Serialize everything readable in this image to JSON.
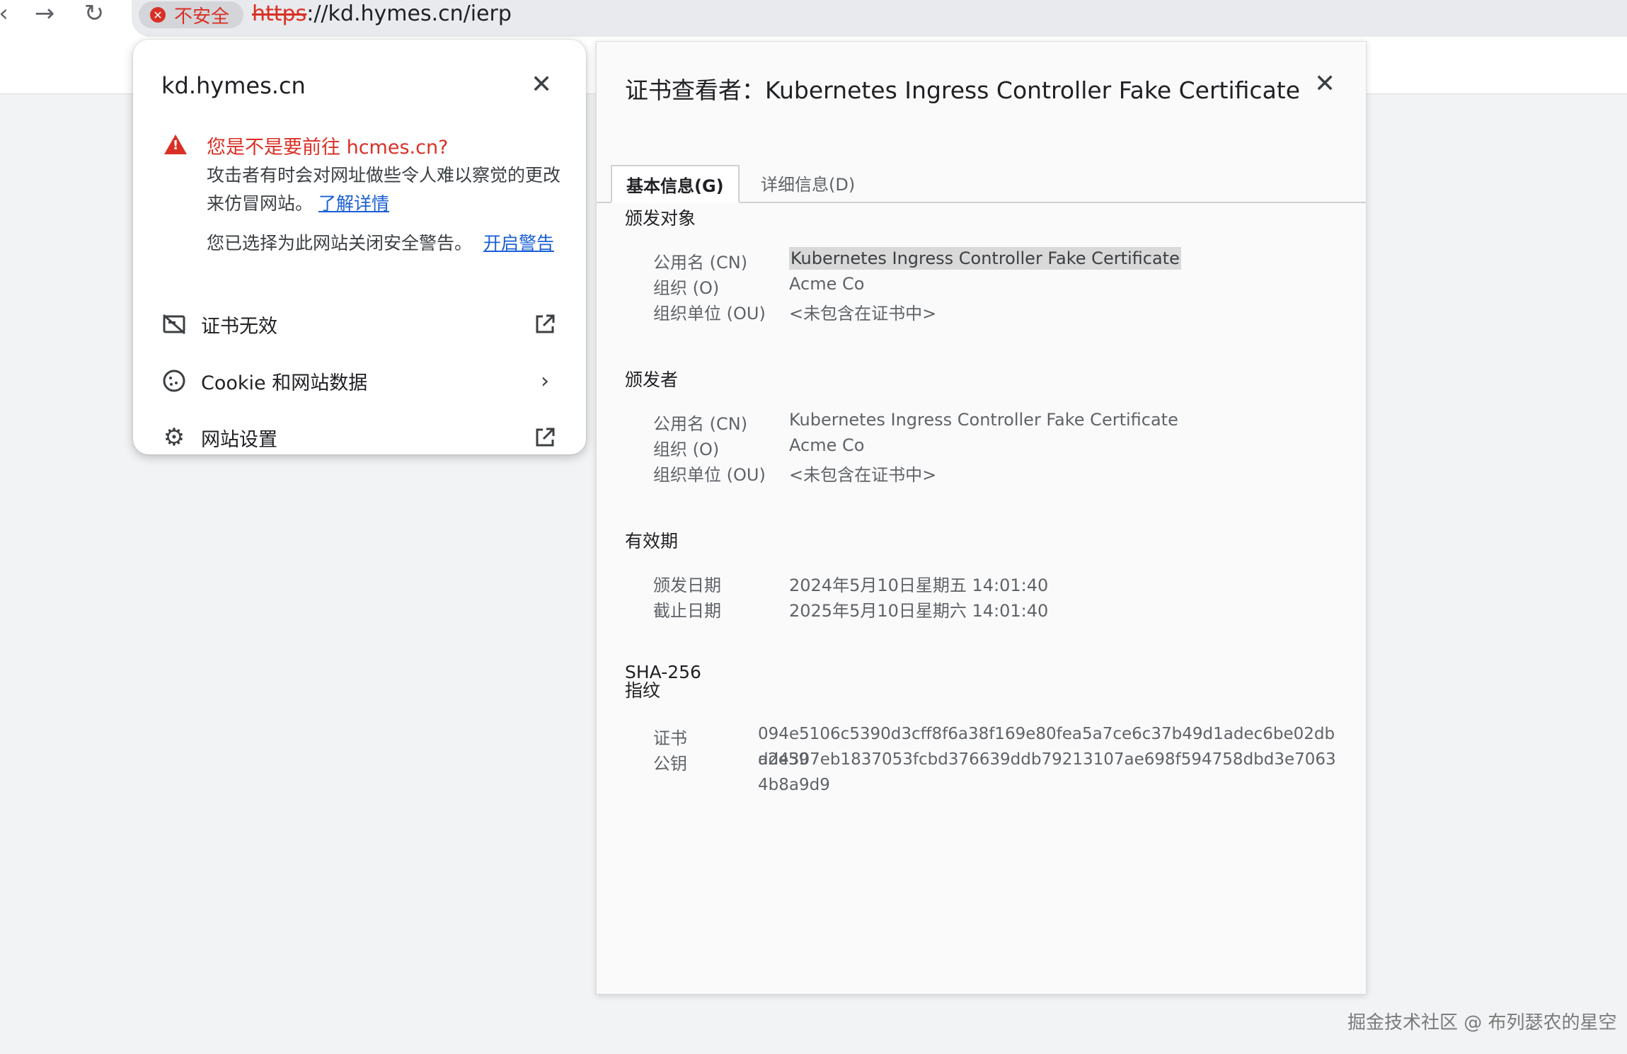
{
  "browser": {
    "security_chip": "不安全",
    "url_scheme": "https",
    "url_rest": "://kd.hymes.cn/ierp"
  },
  "site_info": {
    "host": "kd.hymes.cn",
    "warning_title": "您是不是要前往 hcmes.cn?",
    "warning_body": "攻击者有时会对网址做些令人难以察觉的更改来仿冒网站。",
    "learn_more": "了解详情",
    "optout_text": "您已选择为此网站关闭安全警告。",
    "enable_warnings": "开启警告",
    "items": [
      {
        "label": "证书无效"
      },
      {
        "label": "Cookie 和网站数据"
      },
      {
        "label": "网站设置"
      }
    ]
  },
  "cert_viewer": {
    "title": "证书查看者：Kubernetes Ingress Controller Fake Certificate",
    "tabs": [
      "基本信息(G)",
      "详细信息(D)"
    ],
    "subject": {
      "heading": "颁发对象",
      "cn_label": "公用名 (CN)",
      "cn": "Kubernetes Ingress Controller Fake Certificate",
      "o_label": "组织 (O)",
      "o": "Acme Co",
      "ou_label": "组织单位 (OU)",
      "ou": "<未包含在证书中>"
    },
    "issuer": {
      "heading": "颁发者",
      "cn_label": "公用名 (CN)",
      "cn": "Kubernetes Ingress Controller Fake Certificate",
      "o_label": "组织 (O)",
      "o": "Acme Co",
      "ou_label": "组织单位 (OU)",
      "ou": "<未包含在证书中>"
    },
    "validity": {
      "heading": "有效期",
      "issued_label": "颁发日期",
      "issued": "2024年5月10日星期五 14:01:40",
      "expires_label": "截止日期",
      "expires": "2025年5月10日星期六 14:01:40"
    },
    "fingerprints": {
      "heading": "SHA-256 指纹",
      "cert_label": "证书",
      "cert": "094e5106c5390d3cff8f6a38f169e80fea5a7ce6c37b49d1adec6be02dba2e59",
      "pubkey_label": "公钥",
      "pubkey": "dd4307eb1837053fcbd376639ddb79213107ae698f594758dbd3e70634b8a9d9"
    }
  },
  "watermark": "掘金技术社区 @ 布列瑟农的星空"
}
